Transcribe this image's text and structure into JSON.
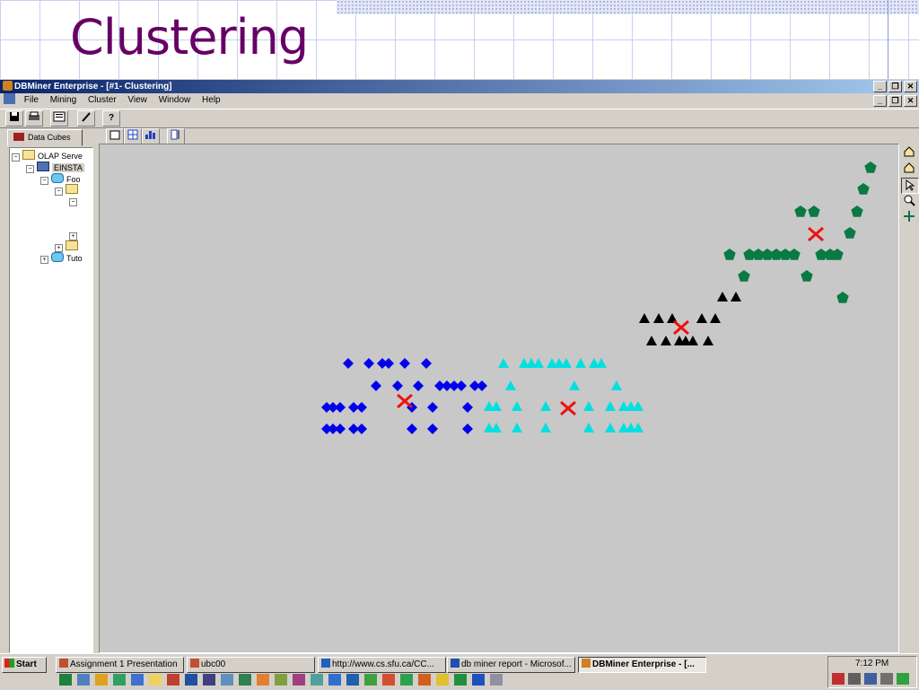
{
  "slide": {
    "title": "Clustering"
  },
  "window": {
    "title": "DBMiner Enterprise - [#1- Clustering]",
    "controls": [
      "_",
      "❐",
      "✕"
    ]
  },
  "menu": [
    "File",
    "Mining",
    "Cluster",
    "View",
    "Window",
    "Help"
  ],
  "toolbar": {
    "help_label": "?"
  },
  "left_pane": {
    "tab_label": "Data Cubes",
    "tree": [
      {
        "label": "OLAP Serve",
        "expander": "−"
      },
      {
        "label": "EINSTA",
        "expander": "−"
      },
      {
        "label": "Foo",
        "expander": "−"
      },
      {
        "label": "",
        "expander": "−"
      },
      {
        "label": "",
        "expander": "−"
      },
      {
        "label": "",
        "expander": "+"
      },
      {
        "label": "",
        "expander": "+"
      },
      {
        "label": "Tuto",
        "expander": "+"
      }
    ]
  },
  "chart_data": {
    "type": "scatter",
    "title": "",
    "xlabel": "",
    "ylabel": "",
    "grid": false,
    "clusters": [
      {
        "shape": "pentagon",
        "color": "#0a7a44",
        "points": [
          [
            970,
            187
          ],
          [
            962,
            211
          ],
          [
            892,
            236
          ],
          [
            907,
            236
          ],
          [
            955,
            236
          ],
          [
            947,
            260
          ],
          [
            813,
            284
          ],
          [
            835,
            284
          ],
          [
            845,
            284
          ],
          [
            855,
            284
          ],
          [
            865,
            284
          ],
          [
            875,
            284
          ],
          [
            885,
            284
          ],
          [
            915,
            284
          ],
          [
            925,
            284
          ],
          [
            933,
            284
          ],
          [
            829,
            308
          ],
          [
            899,
            308
          ],
          [
            939,
            332
          ]
        ]
      },
      {
        "shape": "triangle",
        "color": "#000000",
        "points": [
          [
            805,
            331
          ],
          [
            820,
            331
          ],
          [
            718,
            355
          ],
          [
            734,
            355
          ],
          [
            749,
            355
          ],
          [
            782,
            355
          ],
          [
            797,
            355
          ],
          [
            726,
            380
          ],
          [
            742,
            380
          ],
          [
            757,
            380
          ],
          [
            764,
            380
          ],
          [
            772,
            380
          ],
          [
            789,
            380
          ]
        ]
      },
      {
        "shape": "diamond",
        "color": "#0000ee",
        "points": [
          [
            388,
            405
          ],
          [
            411,
            405
          ],
          [
            426,
            405
          ],
          [
            433,
            405
          ],
          [
            451,
            405
          ],
          [
            475,
            405
          ],
          [
            419,
            430
          ],
          [
            443,
            430
          ],
          [
            466,
            430
          ],
          [
            490,
            430
          ],
          [
            498,
            430
          ],
          [
            506,
            430
          ],
          [
            514,
            430
          ],
          [
            529,
            430
          ],
          [
            537,
            430
          ],
          [
            364,
            454
          ],
          [
            371,
            454
          ],
          [
            379,
            454
          ],
          [
            394,
            454
          ],
          [
            403,
            454
          ],
          [
            459,
            454
          ],
          [
            482,
            454
          ],
          [
            521,
            454
          ],
          [
            364,
            478
          ],
          [
            371,
            478
          ],
          [
            379,
            478
          ],
          [
            394,
            478
          ],
          [
            403,
            478
          ],
          [
            459,
            478
          ],
          [
            482,
            478
          ],
          [
            521,
            478
          ]
        ]
      },
      {
        "shape": "triangle",
        "color": "#00e0e0",
        "points": [
          [
            561,
            405
          ],
          [
            584,
            405
          ],
          [
            592,
            405
          ],
          [
            600,
            405
          ],
          [
            615,
            405
          ],
          [
            623,
            405
          ],
          [
            631,
            405
          ],
          [
            647,
            405
          ],
          [
            662,
            405
          ],
          [
            670,
            405
          ],
          [
            569,
            430
          ],
          [
            640,
            430
          ],
          [
            687,
            430
          ],
          [
            545,
            453
          ],
          [
            553,
            453
          ],
          [
            576,
            453
          ],
          [
            608,
            453
          ],
          [
            656,
            453
          ],
          [
            680,
            453
          ],
          [
            695,
            453
          ],
          [
            703,
            453
          ],
          [
            711,
            453
          ],
          [
            545,
            477
          ],
          [
            553,
            477
          ],
          [
            576,
            477
          ],
          [
            608,
            477
          ],
          [
            656,
            477
          ],
          [
            680,
            477
          ],
          [
            695,
            477
          ],
          [
            703,
            477
          ],
          [
            711,
            477
          ]
        ]
      }
    ],
    "centroids": [
      [
        909,
        261
      ],
      [
        759,
        365
      ],
      [
        451,
        447
      ],
      [
        633,
        455
      ]
    ],
    "centroid_color": "#ee1111"
  },
  "taskbar": {
    "start_label": "Start",
    "tasks": [
      {
        "label": "Assignment 1 Presentation",
        "active": false
      },
      {
        "label": "ubc00",
        "active": false
      },
      {
        "label": "http://www.cs.sfu.ca/CC...",
        "active": false
      },
      {
        "label": "db miner report - Microsof...",
        "active": false
      },
      {
        "label": "DBMiner Enterprise - [...",
        "active": true
      }
    ],
    "clock": "7:12 PM"
  }
}
